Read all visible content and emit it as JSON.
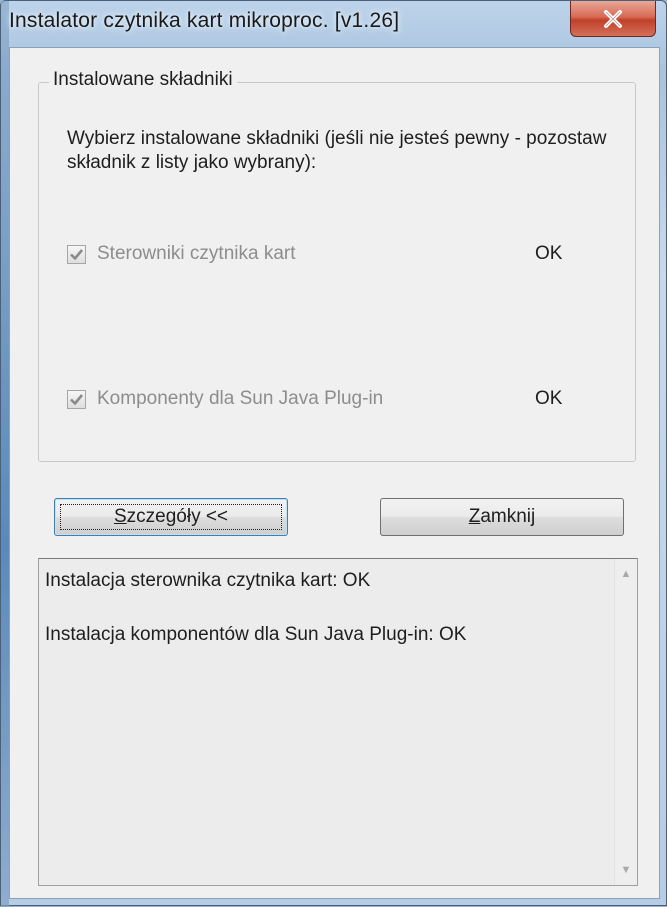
{
  "window": {
    "title": "Instalator czytnika kart mikroproc. [v1.26]",
    "close_icon": "close-x-icon"
  },
  "group": {
    "label": "Instalowane składniki",
    "instruction": "Wybierz instalowane składniki (jeśli nie jesteś pewny - pozostaw składnik z listy jako wybrany):",
    "components": [
      {
        "label": "Sterowniki czytnika kart",
        "status": "OK",
        "checked": true,
        "enabled": false
      },
      {
        "label": "Komponenty dla Sun Java Plug-in",
        "status": "OK",
        "checked": true,
        "enabled": false
      }
    ]
  },
  "buttons": {
    "details_mnemonic": "S",
    "details_rest": "zczegóły <<",
    "close_mnemonic": "Z",
    "close_rest": "amknij"
  },
  "log": {
    "lines": [
      "Instalacja sterownika czytnika kart: OK",
      "Instalacja komponentów dla Sun Java Plug-in: OK"
    ]
  },
  "colors": {
    "close_button": "#c84a34",
    "disabled_text": "#8d8d8d",
    "dialog_bg": "#f0f0f0"
  }
}
